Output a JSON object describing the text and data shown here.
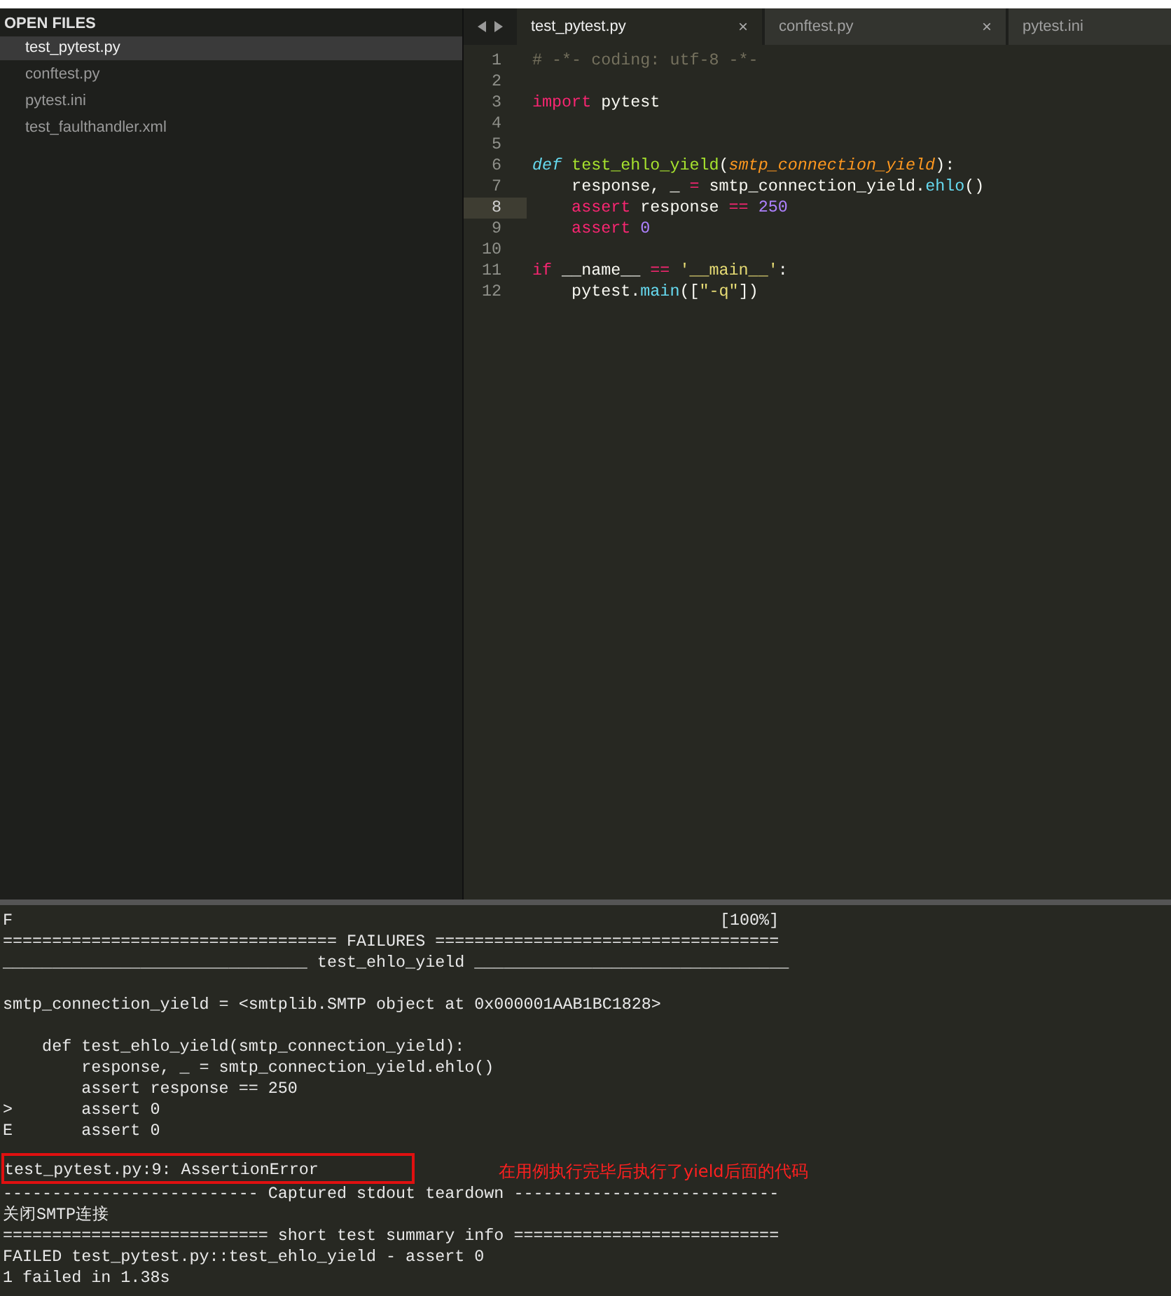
{
  "sidebar": {
    "header": "OPEN FILES",
    "items": [
      {
        "label": "test_pytest.py",
        "selected": true
      },
      {
        "label": "conftest.py",
        "selected": false
      },
      {
        "label": "pytest.ini",
        "selected": false
      },
      {
        "label": "test_faulthandler.xml",
        "selected": false
      }
    ]
  },
  "tabs": [
    {
      "label": "test_pytest.py",
      "selected": true,
      "close": "×"
    },
    {
      "label": "conftest.py",
      "selected": false,
      "close": "×"
    },
    {
      "label": "pytest.ini",
      "selected": false
    }
  ],
  "editor": {
    "lines": [
      {
        "number": "1",
        "highlighted": false,
        "tokens": [
          {
            "text": "# -*- coding: utf-8 -*-",
            "kind": "comment"
          }
        ]
      },
      {
        "number": "2",
        "highlighted": false
      },
      {
        "number": "3",
        "highlighted": false,
        "tokens": [
          {
            "text": "import",
            "kind": "keyword"
          },
          {
            "text": " pytest",
            "kind": "plain"
          }
        ]
      },
      {
        "number": "4",
        "highlighted": false
      },
      {
        "number": "5",
        "highlighted": false
      },
      {
        "number": "6",
        "highlighted": false,
        "tokens": [
          {
            "text": "def",
            "kind": "storage"
          },
          {
            "text": " test_ehlo_yield",
            "kind": "function"
          },
          {
            "text": "(",
            "kind": "plain"
          },
          {
            "text": "smtp_connection_yield",
            "kind": "param"
          },
          {
            "text": "):",
            "kind": "plain"
          }
        ]
      },
      {
        "number": "7",
        "highlighted": false,
        "tokens": [
          {
            "text": "    response, _ ",
            "kind": "plain"
          },
          {
            "text": "=",
            "kind": "keyword"
          },
          {
            "text": " smtp_connection_yield.",
            "kind": "plain"
          },
          {
            "text": "ehlo",
            "kind": "builtin"
          },
          {
            "text": "()",
            "kind": "plain"
          }
        ]
      },
      {
        "number": "8",
        "highlighted": true,
        "tokens": [
          {
            "text": "    assert",
            "kind": "keyword"
          },
          {
            "text": " response ",
            "kind": "plain"
          },
          {
            "text": "==",
            "kind": "keyword"
          },
          {
            "text": " 250",
            "kind": "number"
          }
        ]
      },
      {
        "number": "9",
        "highlighted": false,
        "tokens": [
          {
            "text": "    assert",
            "kind": "keyword"
          },
          {
            "text": " 0",
            "kind": "number"
          }
        ]
      },
      {
        "number": "10",
        "highlighted": false
      },
      {
        "number": "11",
        "highlighted": false,
        "tokens": [
          {
            "text": "if",
            "kind": "keyword"
          },
          {
            "text": " __name__ ",
            "kind": "plain"
          },
          {
            "text": "==",
            "kind": "keyword"
          },
          {
            "text": " '__main__'",
            "kind": "string"
          },
          {
            "text": ":",
            "kind": "plain"
          }
        ]
      },
      {
        "number": "12",
        "highlighted": false,
        "tokens": [
          {
            "text": "    pytest.",
            "kind": "plain"
          },
          {
            "text": "main",
            "kind": "builtin"
          },
          {
            "text": "([",
            "kind": "plain"
          },
          {
            "text": "\"-q\"",
            "kind": "string"
          },
          {
            "text": "])",
            "kind": "plain"
          }
        ]
      }
    ]
  },
  "console": {
    "lines": [
      {
        "kind": "text",
        "text": "F                                                                        [100%]"
      },
      {
        "kind": "text",
        "text": "================================== FAILURES ==================================="
      },
      {
        "kind": "text",
        "text": "_______________________________ test_ehlo_yield ________________________________"
      },
      {
        "kind": "blank"
      },
      {
        "kind": "text",
        "text": "smtp_connection_yield = <smtplib.SMTP object at 0x000001AAB1BC1828>"
      },
      {
        "kind": "blank"
      },
      {
        "kind": "text",
        "text": "    def test_ehlo_yield(smtp_connection_yield):"
      },
      {
        "kind": "text",
        "text": "        response, _ = smtp_connection_yield.ehlo()"
      },
      {
        "kind": "text",
        "text": "        assert response == 250"
      },
      {
        "kind": "text",
        "text": ">       assert 0"
      },
      {
        "kind": "text",
        "text": "E       assert 0"
      },
      {
        "kind": "blank"
      },
      {
        "kind": "boxed",
        "text": "test_pytest.py:9: AssertionError",
        "note": "在用例执行完毕后执行了yield后面的代码"
      },
      {
        "kind": "text",
        "text": "-------------------------- Captured stdout teardown ---------------------------"
      },
      {
        "kind": "text",
        "text": "关闭SMTP连接"
      },
      {
        "kind": "text",
        "text": "=========================== short test summary info ==========================="
      },
      {
        "kind": "text",
        "text": "FAILED test_pytest.py::test_ehlo_yield - assert 0"
      },
      {
        "kind": "text",
        "text": "1 failed in 1.38s"
      }
    ]
  }
}
